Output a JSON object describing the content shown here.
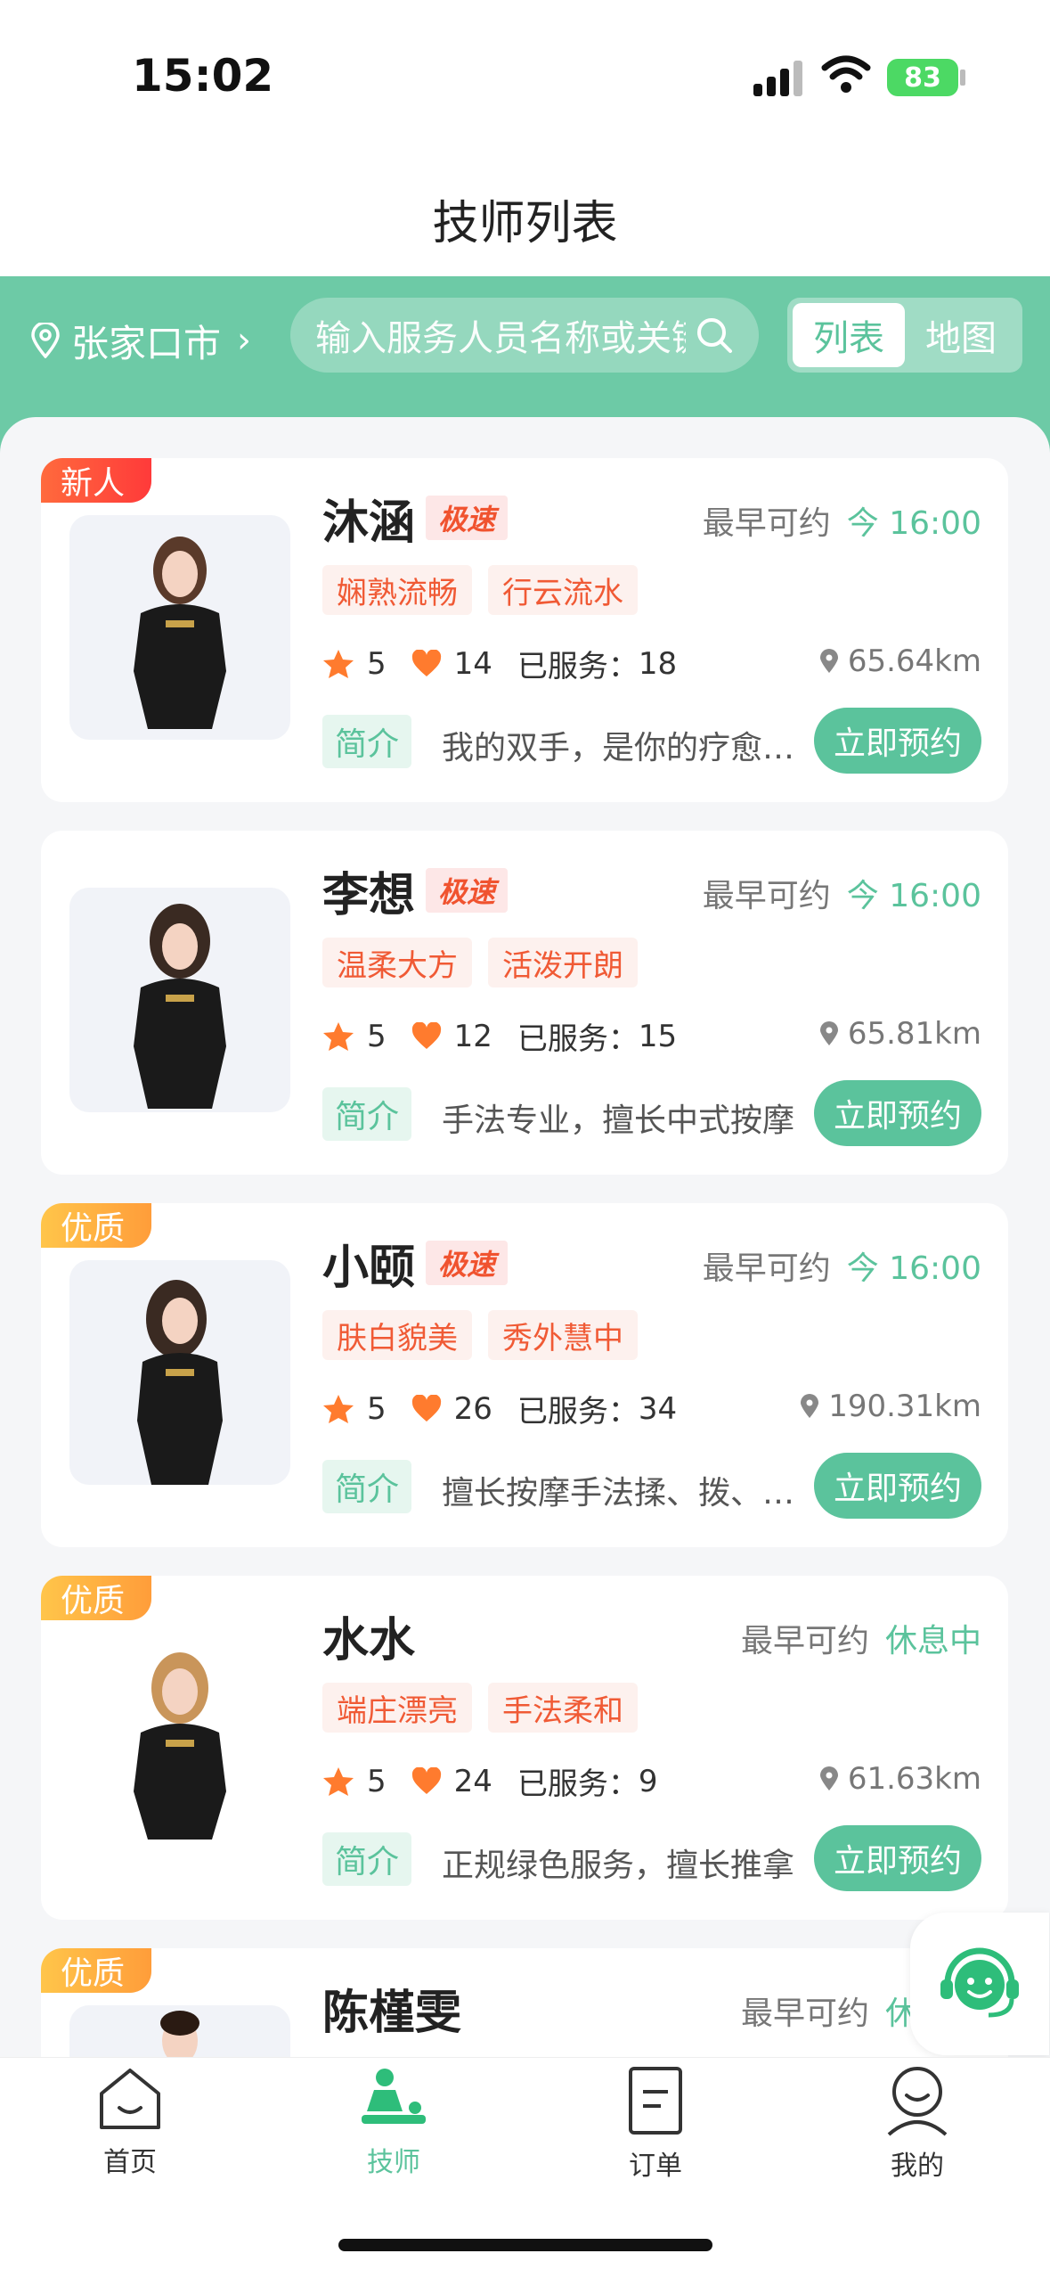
{
  "status": {
    "time": "15:02",
    "battery": "83"
  },
  "page": {
    "title": "技师列表"
  },
  "header": {
    "city": "张家口市",
    "search_placeholder": "输入服务人员名称或关键字",
    "view_list": "列表",
    "view_map": "地图"
  },
  "card_labels": {
    "earliest": "最早可约",
    "served": "已服务：",
    "intro": "简介",
    "book": "立即预约",
    "fast": "极速"
  },
  "technicians": [
    {
      "badge": "新人",
      "name": "沐涵",
      "fast": true,
      "earliest": "今 16:00",
      "tags": [
        "娴熟流畅",
        "行云流水"
      ],
      "rating": "5",
      "likes": "14",
      "served": "18",
      "distance": "65.64km",
      "intro": "我的双手，是你的疗愈之源"
    },
    {
      "badge": "",
      "name": "李想",
      "fast": true,
      "earliest": "今 16:00",
      "tags": [
        "温柔大方",
        "活泼开朗"
      ],
      "rating": "5",
      "likes": "12",
      "served": "15",
      "distance": "65.81km",
      "intro": "手法专业，擅长中式按摩"
    },
    {
      "badge": "优质",
      "name": "小颐",
      "fast": true,
      "earliest": "今 16:00",
      "tags": [
        "肤白貌美",
        "秀外慧中"
      ],
      "rating": "5",
      "likes": "26",
      "served": "34",
      "distance": "190.31km",
      "intro": "擅长按摩手法揉、拨、按等"
    },
    {
      "badge": "优质",
      "name": "水水",
      "fast": false,
      "earliest": "休息中",
      "tags": [
        "端庄漂亮",
        "手法柔和"
      ],
      "rating": "5",
      "likes": "24",
      "served": "9",
      "distance": "61.63km",
      "intro": "正规绿色服务，擅长推拿"
    },
    {
      "badge": "优质",
      "name": "陈槿雯",
      "fast": false,
      "earliest": "休息中",
      "tags": [],
      "rating": "",
      "likes": "",
      "served": "",
      "distance": "",
      "intro": ""
    }
  ],
  "tabbar": [
    {
      "label": "首页",
      "icon": "home-icon"
    },
    {
      "label": "技师",
      "icon": "massage-icon",
      "active": true
    },
    {
      "label": "订单",
      "icon": "order-icon"
    },
    {
      "label": "我的",
      "icon": "profile-icon"
    }
  ],
  "colors": {
    "brand": "#6dcaa6",
    "accent": "#5bc39c",
    "tag_text": "#f05a35"
  }
}
